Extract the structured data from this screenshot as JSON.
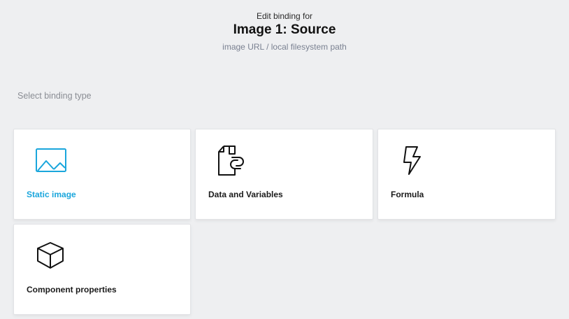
{
  "header": {
    "eyebrow": "Edit binding for",
    "title": "Image 1: Source",
    "subtitle": "image URL / local filesystem path"
  },
  "section_label": "Select binding type",
  "cards": [
    {
      "label": "Static image",
      "icon": "image-icon",
      "selected": true
    },
    {
      "label": "Data and Variables",
      "icon": "linked-file-icon",
      "selected": false
    },
    {
      "label": "Formula",
      "icon": "lightning-bolt-icon",
      "selected": false
    },
    {
      "label": "Component properties",
      "icon": "cube-icon",
      "selected": false
    }
  ],
  "colors": {
    "accent": "#1aa6dc",
    "background": "#eeeff1",
    "card": "#ffffff"
  }
}
